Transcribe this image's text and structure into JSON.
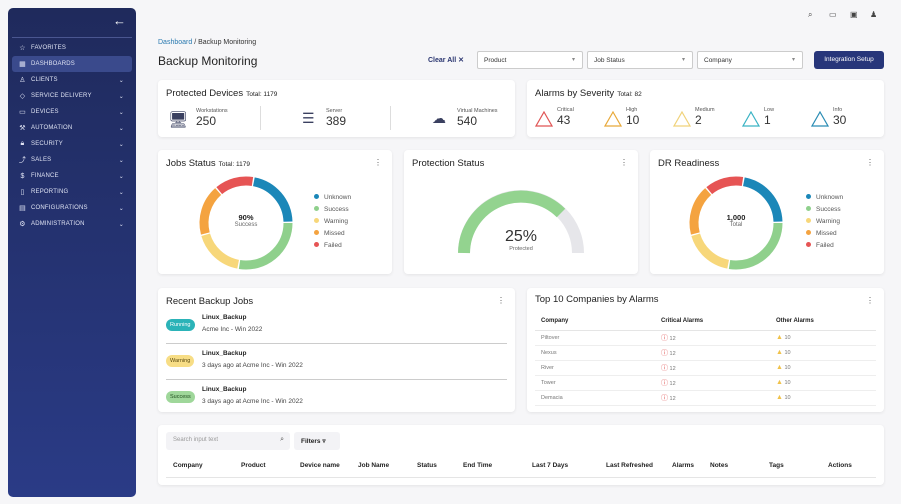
{
  "sidebar": {
    "items": [
      {
        "label": "FAVORITES",
        "icon": "☆",
        "chev": false
      },
      {
        "label": "DASHBOARDS",
        "icon": "▦",
        "chev": false,
        "active": true
      },
      {
        "label": "CLIENTS",
        "icon": "♙",
        "chev": true
      },
      {
        "label": "SERVICE DELIVERY",
        "icon": "◇",
        "chev": true
      },
      {
        "label": "DEVICES",
        "icon": "▭",
        "chev": true
      },
      {
        "label": "AUTOMATION",
        "icon": "⚒",
        "chev": true
      },
      {
        "label": "SECURITY",
        "icon": "🔒︎",
        "chev": true
      },
      {
        "label": "SALES",
        "icon": "⤴",
        "chev": true
      },
      {
        "label": "FINANCE",
        "icon": "$",
        "chev": true
      },
      {
        "label": "REPORTING",
        "icon": "▯",
        "chev": true
      },
      {
        "label": "CONFIGURATIONS",
        "icon": "▤",
        "chev": true
      },
      {
        "label": "ADMINISTRATION",
        "icon": "⚙",
        "chev": true
      }
    ]
  },
  "header": {
    "crumb_link": "Dashboard",
    "crumb_sep": "/",
    "crumb_current": "Backup Monitoring",
    "title": "Backup Monitoring",
    "clear_all": "Clear All ✕",
    "filters": [
      "Product",
      "Job Status",
      "Company"
    ],
    "integration": "Integration Setup"
  },
  "protected": {
    "title": "Protected Devices",
    "total": "Total: 1179",
    "items": [
      {
        "label": "Workstations",
        "value": "250"
      },
      {
        "label": "Server",
        "value": "389"
      },
      {
        "label": "Virtual Machines",
        "value": "540"
      }
    ]
  },
  "alarms": {
    "title": "Alarms by Severity",
    "total": "Total: 82",
    "items": [
      {
        "label": "Critical",
        "value": "43",
        "color": "#e05555"
      },
      {
        "label": "High",
        "value": "10",
        "color": "#e8a93a"
      },
      {
        "label": "Medium",
        "value": "2",
        "color": "#f0d27a"
      },
      {
        "label": "Low",
        "value": "1",
        "color": "#3ab3c4"
      },
      {
        "label": "Info",
        "value": "30",
        "color": "#2a8cb4"
      }
    ]
  },
  "jobs_status": {
    "title": "Jobs Status",
    "total": "Total: 1179",
    "center_value": "90%",
    "center_label": "Success"
  },
  "dr": {
    "title": "DR Readiness",
    "center_value": "1,000",
    "center_label": "Total"
  },
  "legend": [
    {
      "label": "Unknown",
      "color": "#1b87b8"
    },
    {
      "label": "Success",
      "color": "#8fd08c"
    },
    {
      "label": "Warning",
      "color": "#f7d77a"
    },
    {
      "label": "Missed",
      "color": "#f4a340"
    },
    {
      "label": "Failed",
      "color": "#e65454"
    }
  ],
  "protection": {
    "title": "Protection Status",
    "value": "25%",
    "label": "Protected"
  },
  "recent": {
    "title": "Recent Backup Jobs",
    "jobs": [
      {
        "status": "Running",
        "name": "Linux_Backup",
        "sub": "Acme Inc - Win 2022",
        "bg": "#2bb3b8",
        "fg": "#fff"
      },
      {
        "status": "Warning",
        "name": "Linux_Backup",
        "sub": "3 days ago at Acme Inc - Win 2022",
        "bg": "#f7dd85",
        "fg": "#5a4a10"
      },
      {
        "status": "Success",
        "name": "Linux_Backup",
        "sub": "3 days ago at Acme Inc - Win 2022",
        "bg": "#9fd79a",
        "fg": "#1f4d1d"
      }
    ]
  },
  "top10": {
    "title": "Top 10 Companies by Alarms",
    "headers": [
      "Company",
      "Critical Alarms",
      "Other Alarms"
    ],
    "rows": [
      [
        "Piltover",
        "12",
        "10"
      ],
      [
        "Nexus",
        "12",
        "10"
      ],
      [
        "River",
        "12",
        "10"
      ],
      [
        "Tower",
        "12",
        "10"
      ],
      [
        "Demacia",
        "12",
        "10"
      ]
    ]
  },
  "table": {
    "search_placeholder": "Search input text",
    "filters": "Filters",
    "columns": [
      "Company",
      "Product",
      "Device name",
      "Job Name",
      "Status",
      "End Time",
      "Last 7 Days",
      "Last Refreshed",
      "Alarms",
      "Notes",
      "Tags",
      "Actions"
    ]
  }
}
